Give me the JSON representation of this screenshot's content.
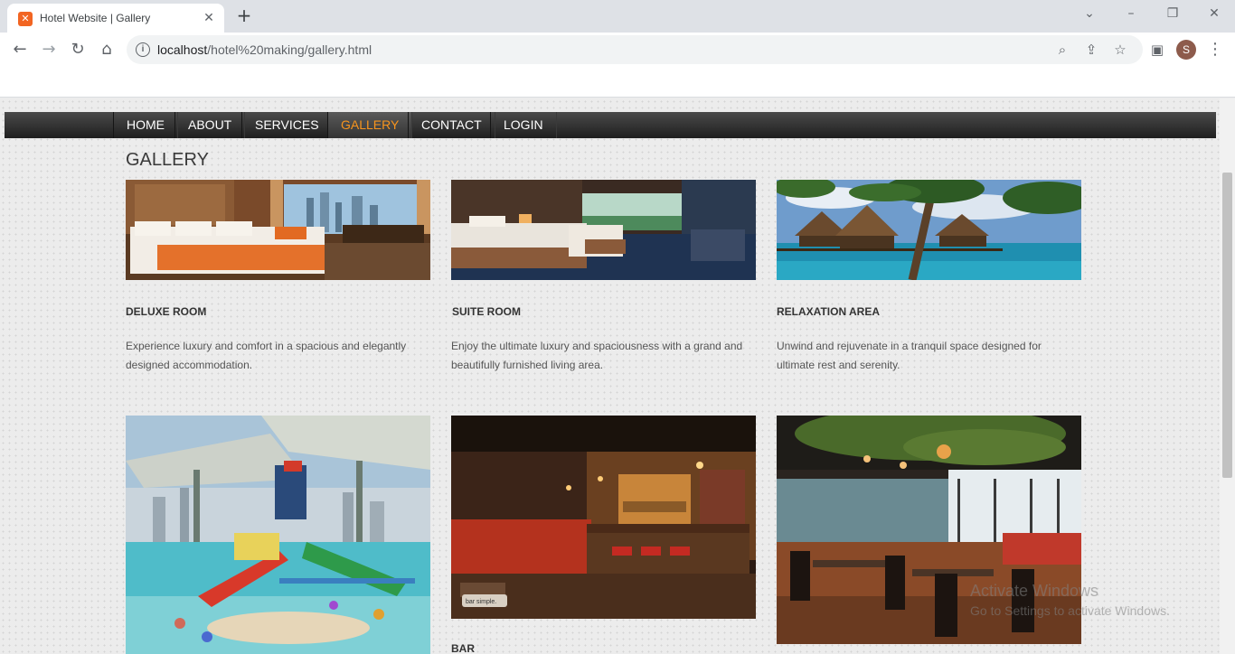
{
  "browser": {
    "tab_title": "Hotel Website | Gallery",
    "tab_icon": "xampp-icon",
    "url_host": "localhost",
    "url_path": "/hotel%20making/gallery.html",
    "profile_initial": "S"
  },
  "nav": {
    "items": [
      {
        "label": "HOME"
      },
      {
        "label": "ABOUT"
      },
      {
        "label": "SERVICES"
      },
      {
        "label": "GALLERY",
        "active": true
      },
      {
        "label": "CONTACT"
      },
      {
        "label": "LOGIN"
      }
    ],
    "active_color": "#f7941d"
  },
  "page": {
    "title": "GALLERY"
  },
  "gallery": [
    {
      "title": "DELUXE ROOM",
      "desc": "Experience luxury and comfort in a spacious and elegantly designed accommodation.",
      "image": "deluxe-room-photo"
    },
    {
      "title": "SUITE ROOM",
      "desc": "Enjoy the ultimate luxury and spaciousness with a grand and beautifully furnished living area.",
      "image": "suite-room-photo"
    },
    {
      "title": "RELAXATION AREA",
      "desc": "Unwind and rejuvenate in a tranquil space designed for ultimate rest and serenity.",
      "image": "overwater-villas-photo"
    },
    {
      "image": "water-park-photo"
    },
    {
      "title": "BAR",
      "image": "bar-photo",
      "sign": "bar simple."
    },
    {
      "image": "restaurant-photo"
    }
  ],
  "watermark": {
    "line1": "Activate Windows",
    "line2": "Go to Settings to activate Windows."
  }
}
